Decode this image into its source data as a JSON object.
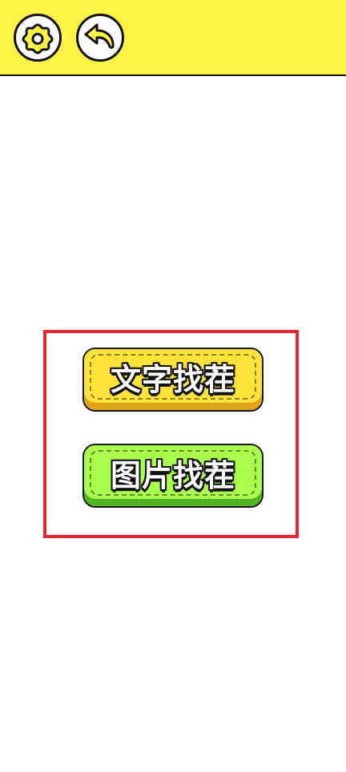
{
  "top_bar": {
    "color": "#fff445",
    "icons": {
      "settings": "gear-icon",
      "back": "undo-arrow-icon"
    }
  },
  "menu": {
    "highlight_color": "#e52733",
    "buttons": [
      {
        "label": "文字找茬",
        "color": "#ffe338"
      },
      {
        "label": "图片找茬",
        "color": "#a9ff4c"
      }
    ]
  }
}
